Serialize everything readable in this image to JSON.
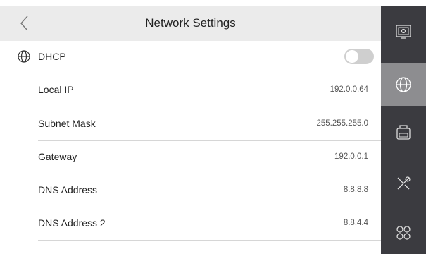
{
  "header": {
    "title": "Network Settings"
  },
  "dhcp": {
    "label": "DHCP",
    "enabled": false
  },
  "fields": [
    {
      "label": "Local IP",
      "value": "192.0.0.64"
    },
    {
      "label": "Subnet Mask",
      "value": "255.255.255.0"
    },
    {
      "label": "Gateway",
      "value": "192.0.0.1"
    },
    {
      "label": "DNS Address",
      "value": "8.8.8.8"
    },
    {
      "label": "DNS Address 2",
      "value": "8.8.4.4"
    }
  ],
  "sidebar": {
    "items": [
      {
        "icon": "settings-display-icon",
        "active": false
      },
      {
        "icon": "globe-icon",
        "active": true
      },
      {
        "icon": "device-icon",
        "active": false
      },
      {
        "icon": "tools-icon",
        "active": false
      },
      {
        "icon": "apps-icon",
        "active": false
      }
    ]
  },
  "colors": {
    "header_bg": "#ebebeb",
    "sidebar_bg": "#3b3b40",
    "sidebar_active": "#8d8d90",
    "toggle_off": "#cfcfcf"
  }
}
